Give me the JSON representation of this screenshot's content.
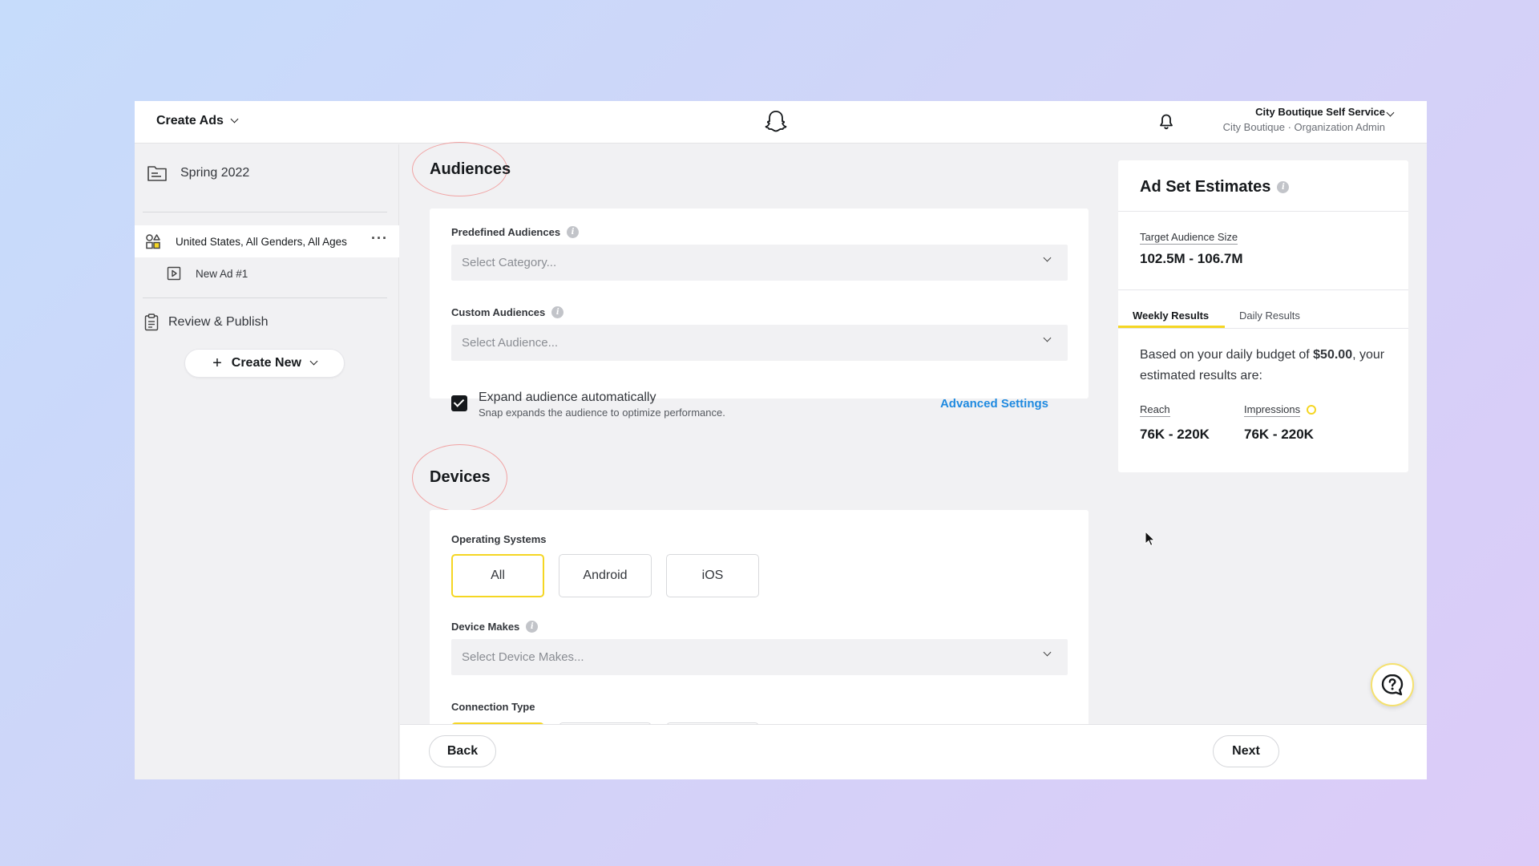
{
  "topbar": {
    "create_ads": "Create Ads",
    "account_name": "City Boutique Self Service",
    "account_role": "City Boutique · Organization Admin"
  },
  "sidebar": {
    "campaign": "Spring 2022",
    "ad_set": "United States, All Genders, All Ages",
    "ad_set_more": "···",
    "ad": "New Ad #1",
    "review": "Review & Publish",
    "create_new": "Create New"
  },
  "audiences": {
    "title": "Audiences",
    "predefined_label": "Predefined Audiences",
    "predefined_placeholder": "Select Category...",
    "custom_label": "Custom Audiences",
    "custom_placeholder": "Select Audience...",
    "expand_checked": true,
    "expand_title": "Expand audience automatically",
    "expand_sub": "Snap expands the audience to optimize performance.",
    "advanced_link": "Advanced Settings"
  },
  "devices": {
    "title": "Devices",
    "os_label": "Operating Systems",
    "os_options": [
      "All",
      "Android",
      "iOS"
    ],
    "os_selected": "All",
    "makes_label": "Device Makes",
    "makes_placeholder": "Select Device Makes...",
    "connection_label": "Connection Type"
  },
  "footer": {
    "back": "Back",
    "next": "Next"
  },
  "estimates": {
    "title": "Ad Set Estimates",
    "target_label": "Target Audience Size",
    "target_value": "102.5M - 106.7M",
    "tabs": [
      "Weekly Results",
      "Daily Results"
    ],
    "active_tab": "Weekly Results",
    "budget_prefix": "Based on your daily budget of ",
    "budget_amount": "$50.00",
    "budget_suffix": ", your estimated results are:",
    "reach_label": "Reach",
    "reach_value": "76K - 220K",
    "impressions_label": "Impressions",
    "impressions_value": "76K - 220K"
  },
  "colors": {
    "accent_yellow": "#f5d623",
    "link_blue": "#1f8ae0",
    "annotation_circle": "#f1a3a3"
  }
}
